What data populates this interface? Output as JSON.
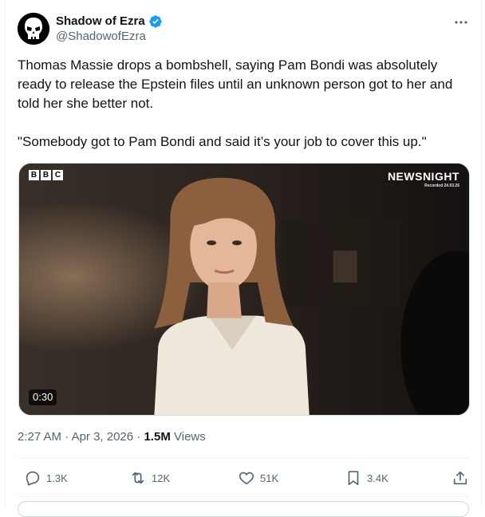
{
  "author": {
    "display_name": "Shadow of Ezra",
    "handle": "@ShadowofEzra",
    "verified_color": "#1d9bf0"
  },
  "tweet": {
    "text": "Thomas Massie drops a bombshell, saying Pam Bondi was absolutely ready to release the Epstein files until an unknown person got to her and told her she better not.\n\n\"Somebody got to Pam Bondi and said it’s your job to cover this up.\""
  },
  "media": {
    "logo_letters": [
      "B",
      "B",
      "C"
    ],
    "program_title": "NEWSNIGHT",
    "recorded_note": "Recorded 24.03.26",
    "duration": "0:30"
  },
  "meta": {
    "time": "2:27 AM",
    "separator": "·",
    "date": "Apr 3, 2026",
    "views_count": "1.5M",
    "views_label": "Views"
  },
  "actions": {
    "replies": "1.3K",
    "reposts": "12K",
    "likes": "51K",
    "bookmarks": "3.4K",
    "icons": [
      "reply-icon",
      "repost-icon",
      "like-icon",
      "bookmark-icon",
      "share-icon"
    ]
  }
}
